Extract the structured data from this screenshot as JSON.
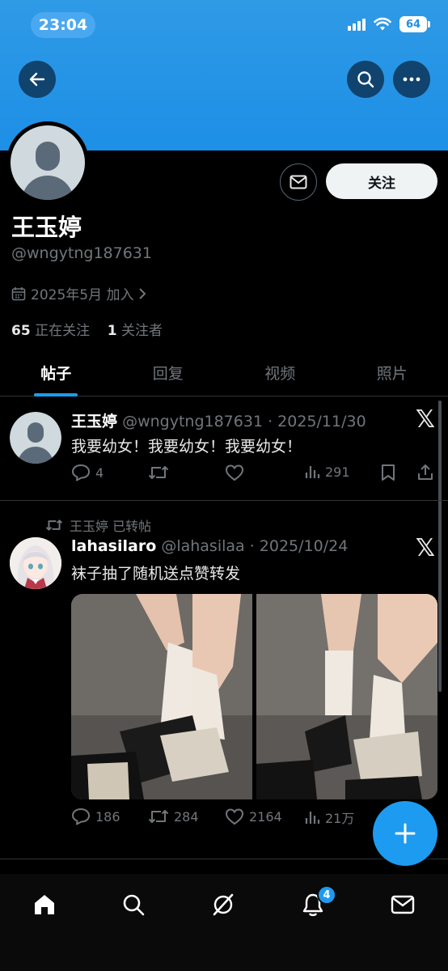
{
  "status_bar": {
    "time": "23:04",
    "battery": "64"
  },
  "profile": {
    "name": "王玉婷",
    "handle": "@wngytng187631",
    "joined": "2025年5月 加入",
    "following_count": "65",
    "following_label": "正在关注",
    "followers_count": "1",
    "followers_label": "关注者",
    "follow_button": "关注"
  },
  "tabs": [
    "帖子",
    "回复",
    "视频",
    "照片"
  ],
  "active_tab": "帖子",
  "posts": [
    {
      "author": "王玉婷",
      "meta": "@wngytng187631 · 2025/11/30",
      "text": "我要幼女！我要幼女！我要幼女！",
      "stats": {
        "replies": "4",
        "views": "291"
      }
    },
    {
      "reposted_by": "王玉婷 已转帖",
      "author": "lahasilaro",
      "meta": "@lahasilaa · 2025/10/24",
      "text": "袜子抽了随机送点赞转发",
      "stats": {
        "replies": "186",
        "retweets": "284",
        "likes": "2164",
        "views": "21万"
      }
    }
  ],
  "brand_mark": "𝕏",
  "notification_badge": "4",
  "colors": {
    "accent": "#1d9bf0",
    "banner": "#1d8fe6",
    "background": "#000000"
  }
}
